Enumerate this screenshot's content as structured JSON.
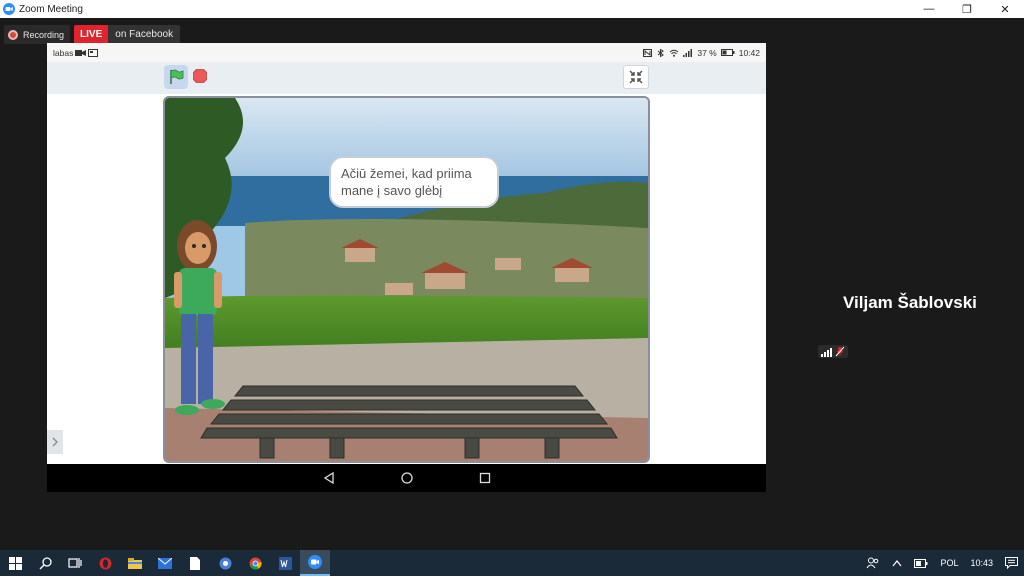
{
  "window": {
    "title": "Zoom Meeting",
    "minimize_glyph": "—",
    "restore_glyph": "❐",
    "close_glyph": "✕"
  },
  "recording": {
    "label": "Recording",
    "live_label": "LIVE",
    "platform_label": "on Facebook"
  },
  "phone_status": {
    "left_text": "labas",
    "battery": "37 %",
    "time": "10:42"
  },
  "stage": {
    "speech_text": "Ačiū žemei, kad priima mane į savo glėbį"
  },
  "participant": {
    "name": "Viljam Šablovski"
  },
  "taskbar": {
    "language": "POL",
    "time": "10:43"
  },
  "colors": {
    "live_red": "#e0232c",
    "zoom_blue": "#2d8cff",
    "scratch_flag": "#4cbf56",
    "scratch_stop": "#ec5959"
  }
}
